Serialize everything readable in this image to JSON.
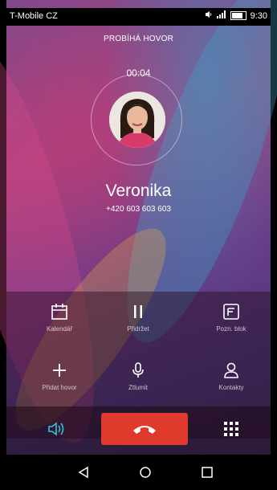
{
  "status_bar": {
    "carrier": "T-Mobile CZ",
    "time": "9:30",
    "icons": [
      "sound-icon",
      "signal-icon",
      "battery-icon"
    ]
  },
  "call": {
    "state": "PROBÍHÁ HOVOR",
    "timer": "00:04",
    "name": "Veronika",
    "number": "+420 603 603 603"
  },
  "actions": [
    {
      "label": "Kalendář",
      "icon": "calendar-icon"
    },
    {
      "label": "Přidržet",
      "icon": "pause-icon"
    },
    {
      "label": "Pozn. blok",
      "icon": "notepad-icon"
    },
    {
      "label": "Přidat hovor",
      "icon": "plus-icon"
    },
    {
      "label": "Ztlumit",
      "icon": "microphone-icon"
    },
    {
      "label": "Kontakty",
      "icon": "contacts-icon"
    }
  ],
  "call_controls": {
    "speaker": "speaker-icon",
    "end": "end-call-icon",
    "dialpad": "dialpad-icon"
  },
  "nav_bar": {
    "items": [
      "back-icon",
      "home-icon",
      "recents-icon"
    ]
  },
  "colors": {
    "end_call": "#e03a2c",
    "speaker_accent": "#2ec7d6"
  }
}
